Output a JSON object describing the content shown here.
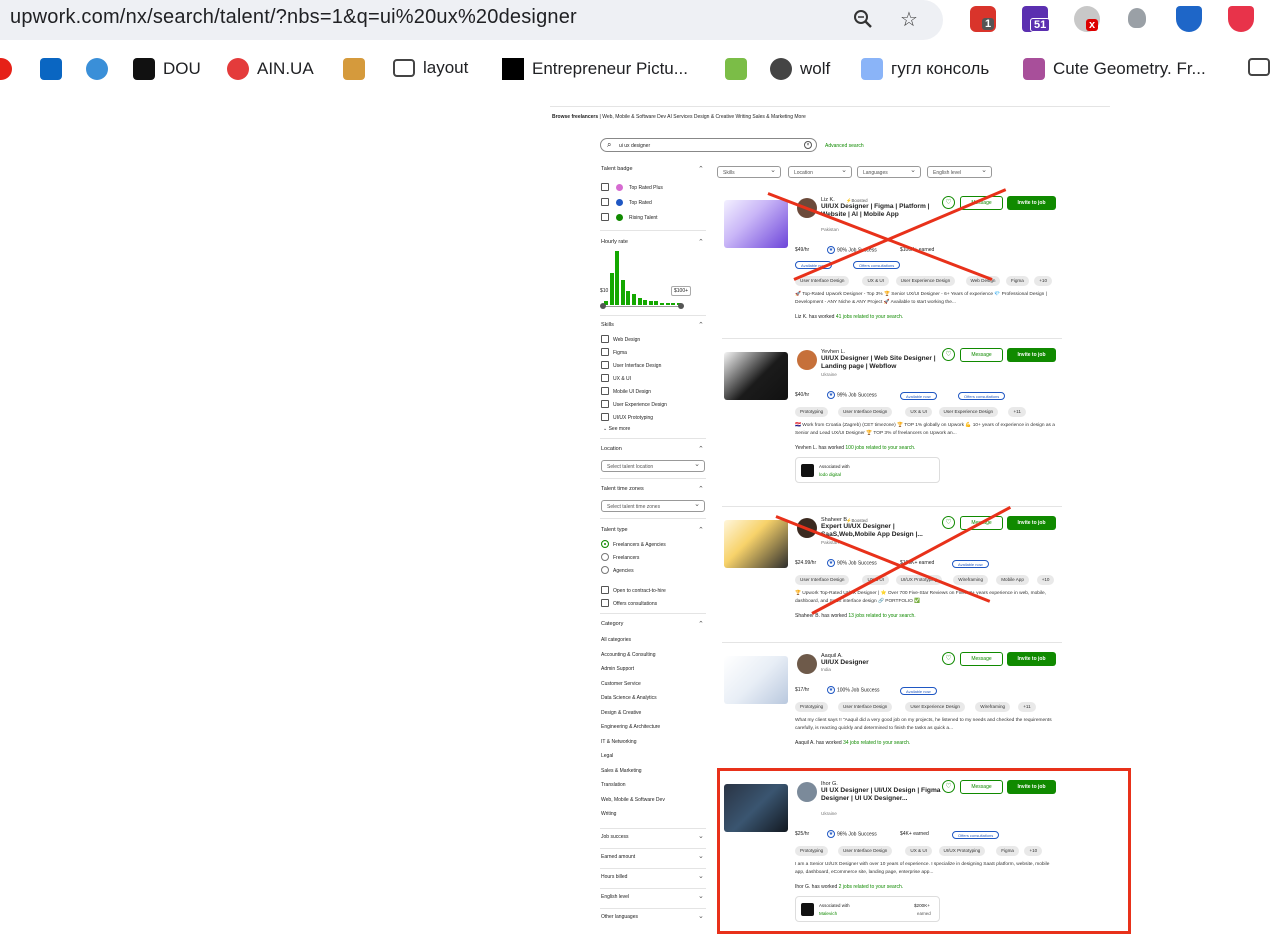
{
  "browser": {
    "url": "upwork.com/nx/search/talent/?nbs=1&q=ui%20ux%20designer",
    "extensions": [
      {
        "name": "adblock-icon",
        "badge": "1",
        "color": "#d9342b"
      },
      {
        "name": "extension-icon",
        "badge": "51",
        "color": "#5b2fb0"
      },
      {
        "name": "extension-icon",
        "badge": "x",
        "color": "#b0b0b0"
      },
      {
        "name": "bulb-icon",
        "badge": "",
        "color": "#9aa0a6"
      },
      {
        "name": "vpn-shield-icon",
        "badge": "",
        "color": "#1e66c8"
      },
      {
        "name": "pocket-icon",
        "badge": "",
        "color": "#e8334a"
      }
    ],
    "bookmarks": [
      "DOU",
      "AIN.UA",
      "layout",
      "Entrepreneur Pictu...",
      "wolf",
      "гугл консоль",
      "Cute Geometry. Fr..."
    ]
  },
  "upwork": {
    "breadcrumb": [
      "Browse freelancers",
      "Web, Mobile & Software Dev",
      "AI Services",
      "Design & Creative",
      "Writing",
      "Sales & Marketing",
      "More"
    ],
    "search": {
      "value": "ui ux designer",
      "advanced": "Advanced search"
    },
    "dropdowns": [
      "Skills",
      "Location",
      "Languages",
      "English level"
    ],
    "sidebar": {
      "talent_badge": {
        "title": "Talent badge",
        "items": [
          "Top Rated Plus",
          "Top Rated",
          "Rising Talent"
        ]
      },
      "hourly_rate": {
        "title": "Hourly rate",
        "min": "$10",
        "max": "$100+",
        "histogram": [
          2,
          18,
          30,
          14,
          8,
          6,
          4,
          3,
          2,
          2,
          1,
          1,
          1,
          1
        ]
      },
      "skills": {
        "title": "Skills",
        "items": [
          "Web Design",
          "Figma",
          "User Interface Design",
          "UX & UI",
          "Mobile UI Design",
          "User Experience Design",
          "UI/UX Prototyping"
        ],
        "see_more": "See more"
      },
      "location": {
        "title": "Location",
        "placeholder": "Select talent location"
      },
      "time_zones": {
        "title": "Talent time zones",
        "placeholder": "Select talent time zones"
      },
      "talent_type": {
        "title": "Talent type",
        "items": [
          "Freelancers & Agencies",
          "Freelancers",
          "Agencies"
        ],
        "selected": 0
      },
      "checks": [
        "Open to contract-to-hire",
        "Offers consultations"
      ],
      "category": {
        "title": "Category",
        "items": [
          "All categories",
          "Accounting & Consulting",
          "Admin Support",
          "Customer Service",
          "Data Science & Analytics",
          "Design & Creative",
          "Engineering & Architecture",
          "IT & Networking",
          "Legal",
          "Sales & Marketing",
          "Translation",
          "Web, Mobile & Software Dev",
          "Writing"
        ]
      },
      "collapsed": [
        "Job success",
        "Earned amount",
        "Hours billed",
        "English level",
        "Other languages"
      ]
    },
    "buttons": {
      "message": "Message",
      "invite": "Invite to job"
    },
    "freelancers": [
      {
        "name": "Liz K.",
        "boosted": "Boosted",
        "title": "UI/UX Designer | Figma | Platform | Website | AI | Mobile App",
        "location": "Pakistan",
        "rate": "$49/hr",
        "job_success": "90% Job Success",
        "earned": "$100K+ earned",
        "pills": [
          "Available now",
          "Offers consultations"
        ],
        "tags": [
          "User Interface Design",
          "UX & UI",
          "User Experience Design",
          "Web Design",
          "Figma",
          "+10"
        ],
        "desc": "🚀 Top-Rated Upwork Designer - Top 3% 🏆 Senior UX/UI Designer - 6+ Years of experience 💎 Professional Design | Development - ANY Niche & ANY Project 🚀 Available to start working the...",
        "worked_prefix": "Liz K. has worked ",
        "worked_link": "41 jobs related to your search."
      },
      {
        "name": "Yevhen L.",
        "title": "UI/UX Designer | Web Site Designer | Landing page | Webflow",
        "location": "Ukraine",
        "rate": "$40/hr",
        "job_success": "99% Job Success",
        "pills": [
          "Available now",
          "Offers consultations"
        ],
        "tags": [
          "Prototyping",
          "User Interface Design",
          "UX & UI",
          "User Experience Design",
          "+11"
        ],
        "desc": "🇭🇷 Work from Croatia (Zagreb) (CET timezone) 🏆 TOP 1% globally on Upwork 💪 10+ years of experience in design as a Senior and Lead UX/UI Designer 🏆 TOP 3% of freelancers on Upwork an...",
        "worked_prefix": "Yevhen L. has worked ",
        "worked_link": "100 jobs related to your search.",
        "assoc_label": "Associated with",
        "assoc_name": "lodo digital"
      },
      {
        "name": "Shaheer B.",
        "boosted": "Boosted",
        "title": "Expert UI/UX Designer | SaaS,Web,Mobile App Design |...",
        "location": "Pakistan",
        "rate": "$24.99/hr",
        "job_success": "90% Job Success",
        "earned": "$100K+ earned",
        "pills": [
          "Available now"
        ],
        "tags": [
          "User Interface Design",
          "UX & UI",
          "UI/UX Prototyping",
          "Wireframing",
          "Mobile App",
          "+10"
        ],
        "desc": "🏆 Upwork Top-Rated UI/UX Designer | ⭐ Over 700 Five-Star Reviews on Fiverr 8+ years experience in web, mobile, dashboard, and SaaS interface design 🔗 PORTFOLIO ✅",
        "worked_prefix": "Shaheer B. has worked ",
        "worked_link": "13 jobs related to your search."
      },
      {
        "name": "Aaquil A.",
        "title": "UI/UX Designer",
        "location": "India",
        "rate": "$17/hr",
        "job_success": "100% Job Success",
        "pills": [
          "Available now"
        ],
        "tags": [
          "Prototyping",
          "User Interface Design",
          "User Experience Design",
          "Wireframing",
          "+11"
        ],
        "desc": "What my client says !! \"Aaquil did a very good job on my projects, he listened to my needs and checked the requirements carefully, is reacting quickly and determined to finish the tasks as quick a...",
        "worked_prefix": "Aaquil A. has worked ",
        "worked_link": "34 jobs related to your search."
      },
      {
        "name": "Ihor G.",
        "title": "UI UX Designer | UI/UX Design | Figma Designer | UI UX Designer...",
        "location": "Ukraine",
        "rate": "$25/hr",
        "job_success": "96% Job Success",
        "earned": "$4K+ earned",
        "pills": [
          "Offers consultations"
        ],
        "tags": [
          "Prototyping",
          "User Interface Design",
          "UX & UI",
          "UI/UX Prototyping",
          "Figma",
          "+10"
        ],
        "desc": "I am a Senior UI/UX Designer with over 10 years of experience. I specialize in designing SaaS platform, website, mobile app, dashboard, eCommerce site, landing page, enterprise app...",
        "worked_prefix": "Ihor G. has worked ",
        "worked_link": "2 jobs related to your search.",
        "assoc_label": "Associated with",
        "assoc_name": "Malevich",
        "assoc_earned": "$200K+",
        "assoc_earned_label": "earned"
      }
    ]
  },
  "colors": {
    "upwork_green": "#108a00",
    "highlight_red": "#e8311a",
    "pill_blue": "#1f57c3"
  }
}
